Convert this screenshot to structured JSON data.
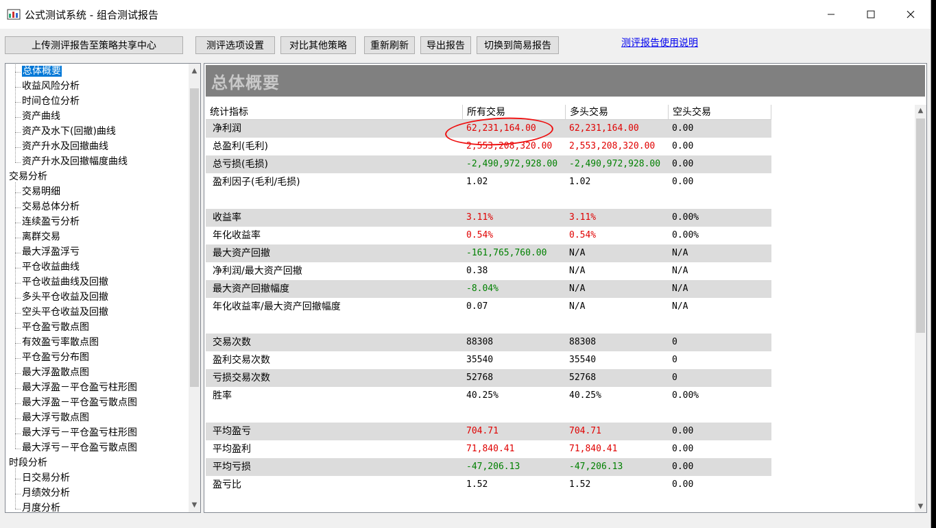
{
  "window": {
    "title": "公式测试系统 - 组合测试报告",
    "controls": {
      "minimize": "—",
      "maximize": "☐",
      "close": "✕"
    }
  },
  "toolbar": {
    "upload": "上传测评报告至策略共享中心",
    "options": "测评选项设置",
    "compare": "对比其他策略",
    "refresh": "重新刷新",
    "export": "导出报告",
    "switch_simple": "切换到简易报告",
    "help_link": "测评报告使用说明"
  },
  "tree": {
    "items": [
      {
        "label": "总体概要",
        "level": 1,
        "selected": true
      },
      {
        "label": "收益风险分析",
        "level": 1
      },
      {
        "label": "时间仓位分析",
        "level": 1
      },
      {
        "label": "资产曲线",
        "level": 1
      },
      {
        "label": "资产及水下(回撤)曲线",
        "level": 1
      },
      {
        "label": "资产升水及回撤曲线",
        "level": 1
      },
      {
        "label": "资产升水及回撤幅度曲线",
        "level": 1
      },
      {
        "label": "交易分析",
        "level": 0
      },
      {
        "label": "交易明细",
        "level": 1
      },
      {
        "label": "交易总体分析",
        "level": 1
      },
      {
        "label": "连续盈亏分析",
        "level": 1
      },
      {
        "label": "离群交易",
        "level": 1
      },
      {
        "label": "最大浮盈浮亏",
        "level": 1
      },
      {
        "label": "平仓收益曲线",
        "level": 1
      },
      {
        "label": "平仓收益曲线及回撤",
        "level": 1
      },
      {
        "label": "多头平仓收益及回撤",
        "level": 1
      },
      {
        "label": "空头平仓收益及回撤",
        "level": 1
      },
      {
        "label": "平仓盈亏散点图",
        "level": 1
      },
      {
        "label": "有效盈亏率散点图",
        "level": 1
      },
      {
        "label": "平仓盈亏分布图",
        "level": 1
      },
      {
        "label": "最大浮盈散点图",
        "level": 1
      },
      {
        "label": "最大浮盈－平仓盈亏柱形图",
        "level": 1
      },
      {
        "label": "最大浮盈－平仓盈亏散点图",
        "level": 1
      },
      {
        "label": "最大浮亏散点图",
        "level": 1
      },
      {
        "label": "最大浮亏－平仓盈亏柱形图",
        "level": 1
      },
      {
        "label": "最大浮亏－平仓盈亏散点图",
        "level": 1
      },
      {
        "label": "时段分析",
        "level": 0
      },
      {
        "label": "日交易分析",
        "level": 1
      },
      {
        "label": "月绩效分析",
        "level": 1
      },
      {
        "label": "月度分析",
        "level": 1
      }
    ]
  },
  "report": {
    "banner_title": "总体概要",
    "columns": [
      "统计指标",
      "所有交易",
      "多头交易",
      "空头交易"
    ],
    "rows": [
      {
        "label": "净利润",
        "all": "62,231,164.00",
        "long": "62,231,164.00",
        "short": "0.00",
        "color": "red",
        "shade": true
      },
      {
        "label": "总盈利(毛利)",
        "all": "2,553,208,320.00",
        "long": "2,553,208,320.00",
        "short": "0.00",
        "color": "red",
        "shade": false
      },
      {
        "label": "总亏损(毛损)",
        "all": "-2,490,972,928.00",
        "long": "-2,490,972,928.00",
        "short": "0.00",
        "color": "green",
        "shade": true
      },
      {
        "label": "盈利因子(毛利/毛损)",
        "all": "1.02",
        "long": "1.02",
        "short": "0.00",
        "color": "black",
        "shade": false
      },
      {
        "spacer": true
      },
      {
        "label": "收益率",
        "all": "3.11%",
        "long": "3.11%",
        "short": "0.00%",
        "color": "red",
        "shade": true
      },
      {
        "label": "年化收益率",
        "all": "0.54%",
        "long": "0.54%",
        "short": "0.00%",
        "color": "red",
        "shade": false
      },
      {
        "label": "最大资产回撤",
        "all": "-161,765,760.00",
        "long": "N/A",
        "short": "N/A",
        "color": "green",
        "shade": true
      },
      {
        "label": "净利润/最大资产回撤",
        "all": "0.38",
        "long": "N/A",
        "short": "N/A",
        "color": "black",
        "shade": false
      },
      {
        "label": "最大资产回撤幅度",
        "all": "-8.04%",
        "long": "N/A",
        "short": "N/A",
        "color": "green",
        "shade": true
      },
      {
        "label": "年化收益率/最大资产回撤幅度",
        "all": "0.07",
        "long": "N/A",
        "short": "N/A",
        "color": "black",
        "shade": false
      },
      {
        "spacer": true
      },
      {
        "label": "交易次数",
        "all": "88308",
        "long": "88308",
        "short": "0",
        "color": "black",
        "shade": true
      },
      {
        "label": "盈利交易次数",
        "all": "35540",
        "long": "35540",
        "short": "0",
        "color": "black",
        "shade": false
      },
      {
        "label": "亏损交易次数",
        "all": "52768",
        "long": "52768",
        "short": "0",
        "color": "black",
        "shade": true
      },
      {
        "label": "胜率",
        "all": "40.25%",
        "long": "40.25%",
        "short": "0.00%",
        "color": "black",
        "shade": false
      },
      {
        "spacer": true
      },
      {
        "label": "平均盈亏",
        "all": "704.71",
        "long": "704.71",
        "short": "0.00",
        "color": "red",
        "shade": true
      },
      {
        "label": "平均盈利",
        "all": "71,840.41",
        "long": "71,840.41",
        "short": "0.00",
        "color": "red",
        "shade": false
      },
      {
        "label": "平均亏损",
        "all": "-47,206.13",
        "long": "-47,206.13",
        "short": "0.00",
        "color": "green",
        "shade": true
      },
      {
        "label": "盈亏比",
        "all": "1.52",
        "long": "1.52",
        "short": "0.00",
        "color": "black",
        "shade": false
      }
    ]
  },
  "colors": {
    "red": "#e00000",
    "green": "#008000",
    "selection": "#0078d7",
    "banner": "#808080"
  }
}
